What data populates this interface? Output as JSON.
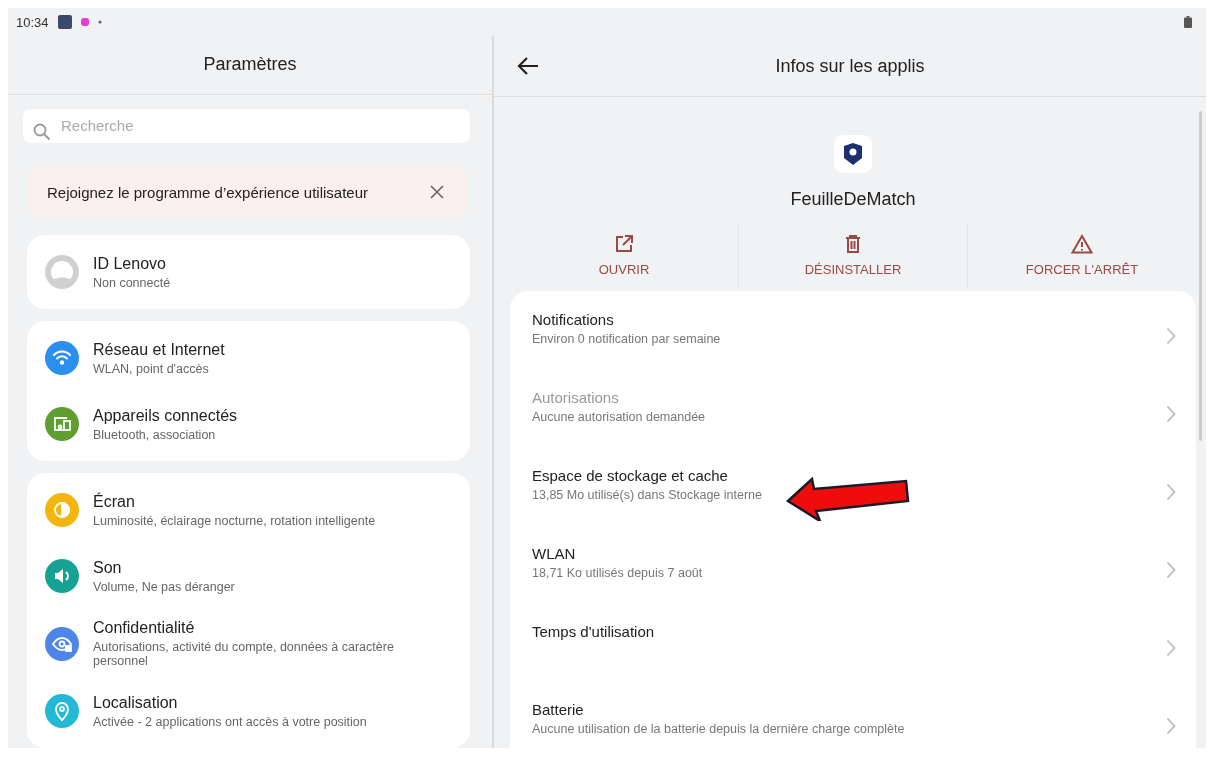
{
  "status_bar": {
    "time": "10:34"
  },
  "settings": {
    "title": "Paramètres",
    "search": {
      "placeholder": "Recherche"
    },
    "banner": {
      "text": "Rejoignez le programme d’expérience utilisateur"
    },
    "groups": [
      {
        "items": [
          {
            "kind": "account",
            "title": "ID Lenovo",
            "subtitle": "Non connecté"
          }
        ]
      },
      {
        "items": [
          {
            "kind": "wifi",
            "title": "Réseau et Internet",
            "subtitle": "WLAN, point d'accès",
            "color": "#2b8ff0"
          },
          {
            "kind": "devices",
            "title": "Appareils connectés",
            "subtitle": "Bluetooth, association",
            "color": "#5f9e31"
          }
        ]
      },
      {
        "items": [
          {
            "kind": "display",
            "title": "Écran",
            "subtitle": "Luminosité, éclairage nocturne, rotation intelligente",
            "color": "#f5b50f"
          },
          {
            "kind": "sound",
            "title": "Son",
            "subtitle": "Volume, Ne pas déranger",
            "color": "#16a396"
          },
          {
            "kind": "privacy",
            "title": "Confidentialité",
            "subtitle": "Autorisations, activité du compte, données à caractère personnel",
            "color": "#4e86e8"
          },
          {
            "kind": "location",
            "title": "Localisation",
            "subtitle": "Activée - 2 applications ont accès à votre position",
            "color": "#22b8d6"
          }
        ]
      }
    ]
  },
  "app_info": {
    "title": "Infos sur les applis",
    "app_name": "FeuilleDeMatch",
    "actions": [
      {
        "kind": "open",
        "label": "OUVRIR"
      },
      {
        "kind": "uninstall",
        "label": "DÉSINSTALLER"
      },
      {
        "kind": "stop",
        "label": "FORCER L'ARRÊT"
      }
    ],
    "rows": [
      {
        "title": "Notifications",
        "subtitle": "Environ 0 notification par semaine",
        "disabled": false
      },
      {
        "title": "Autorisations",
        "subtitle": "Aucune autorisation demandée",
        "disabled": true
      },
      {
        "title": "Espace de stockage et cache",
        "subtitle": "13,85 Mo utilisé(s) dans Stockage interne",
        "disabled": false
      },
      {
        "title": "WLAN",
        "subtitle": "18,71 Ko utilisés depuis 7 août",
        "disabled": false
      },
      {
        "title": "Temps d'utilisation",
        "disabled": false
      },
      {
        "title": "Batterie",
        "subtitle": "Aucune utilisation de la batterie depuis la dernière charge complète",
        "disabled": false
      }
    ]
  }
}
